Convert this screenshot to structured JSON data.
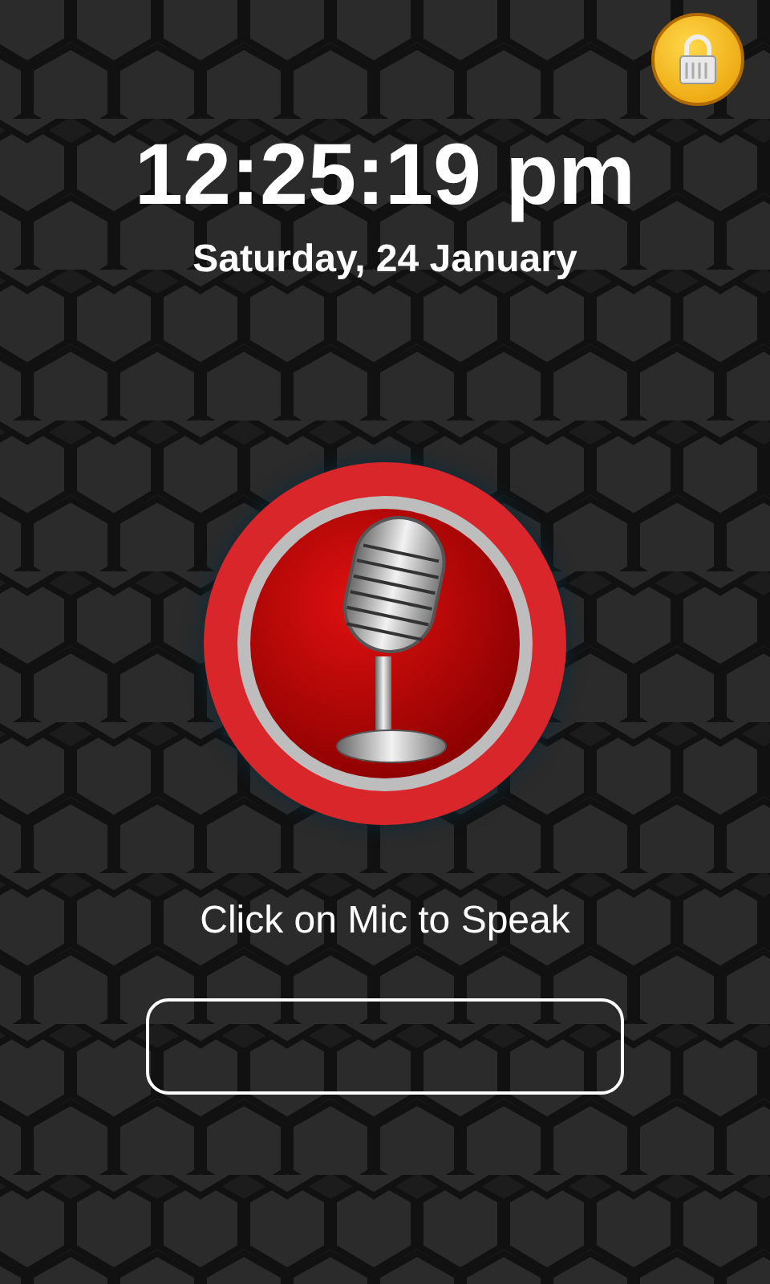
{
  "clock": {
    "time": "12:25:19 pm",
    "date": "Saturday, 24 January"
  },
  "hint": "Click on Mic to Speak"
}
